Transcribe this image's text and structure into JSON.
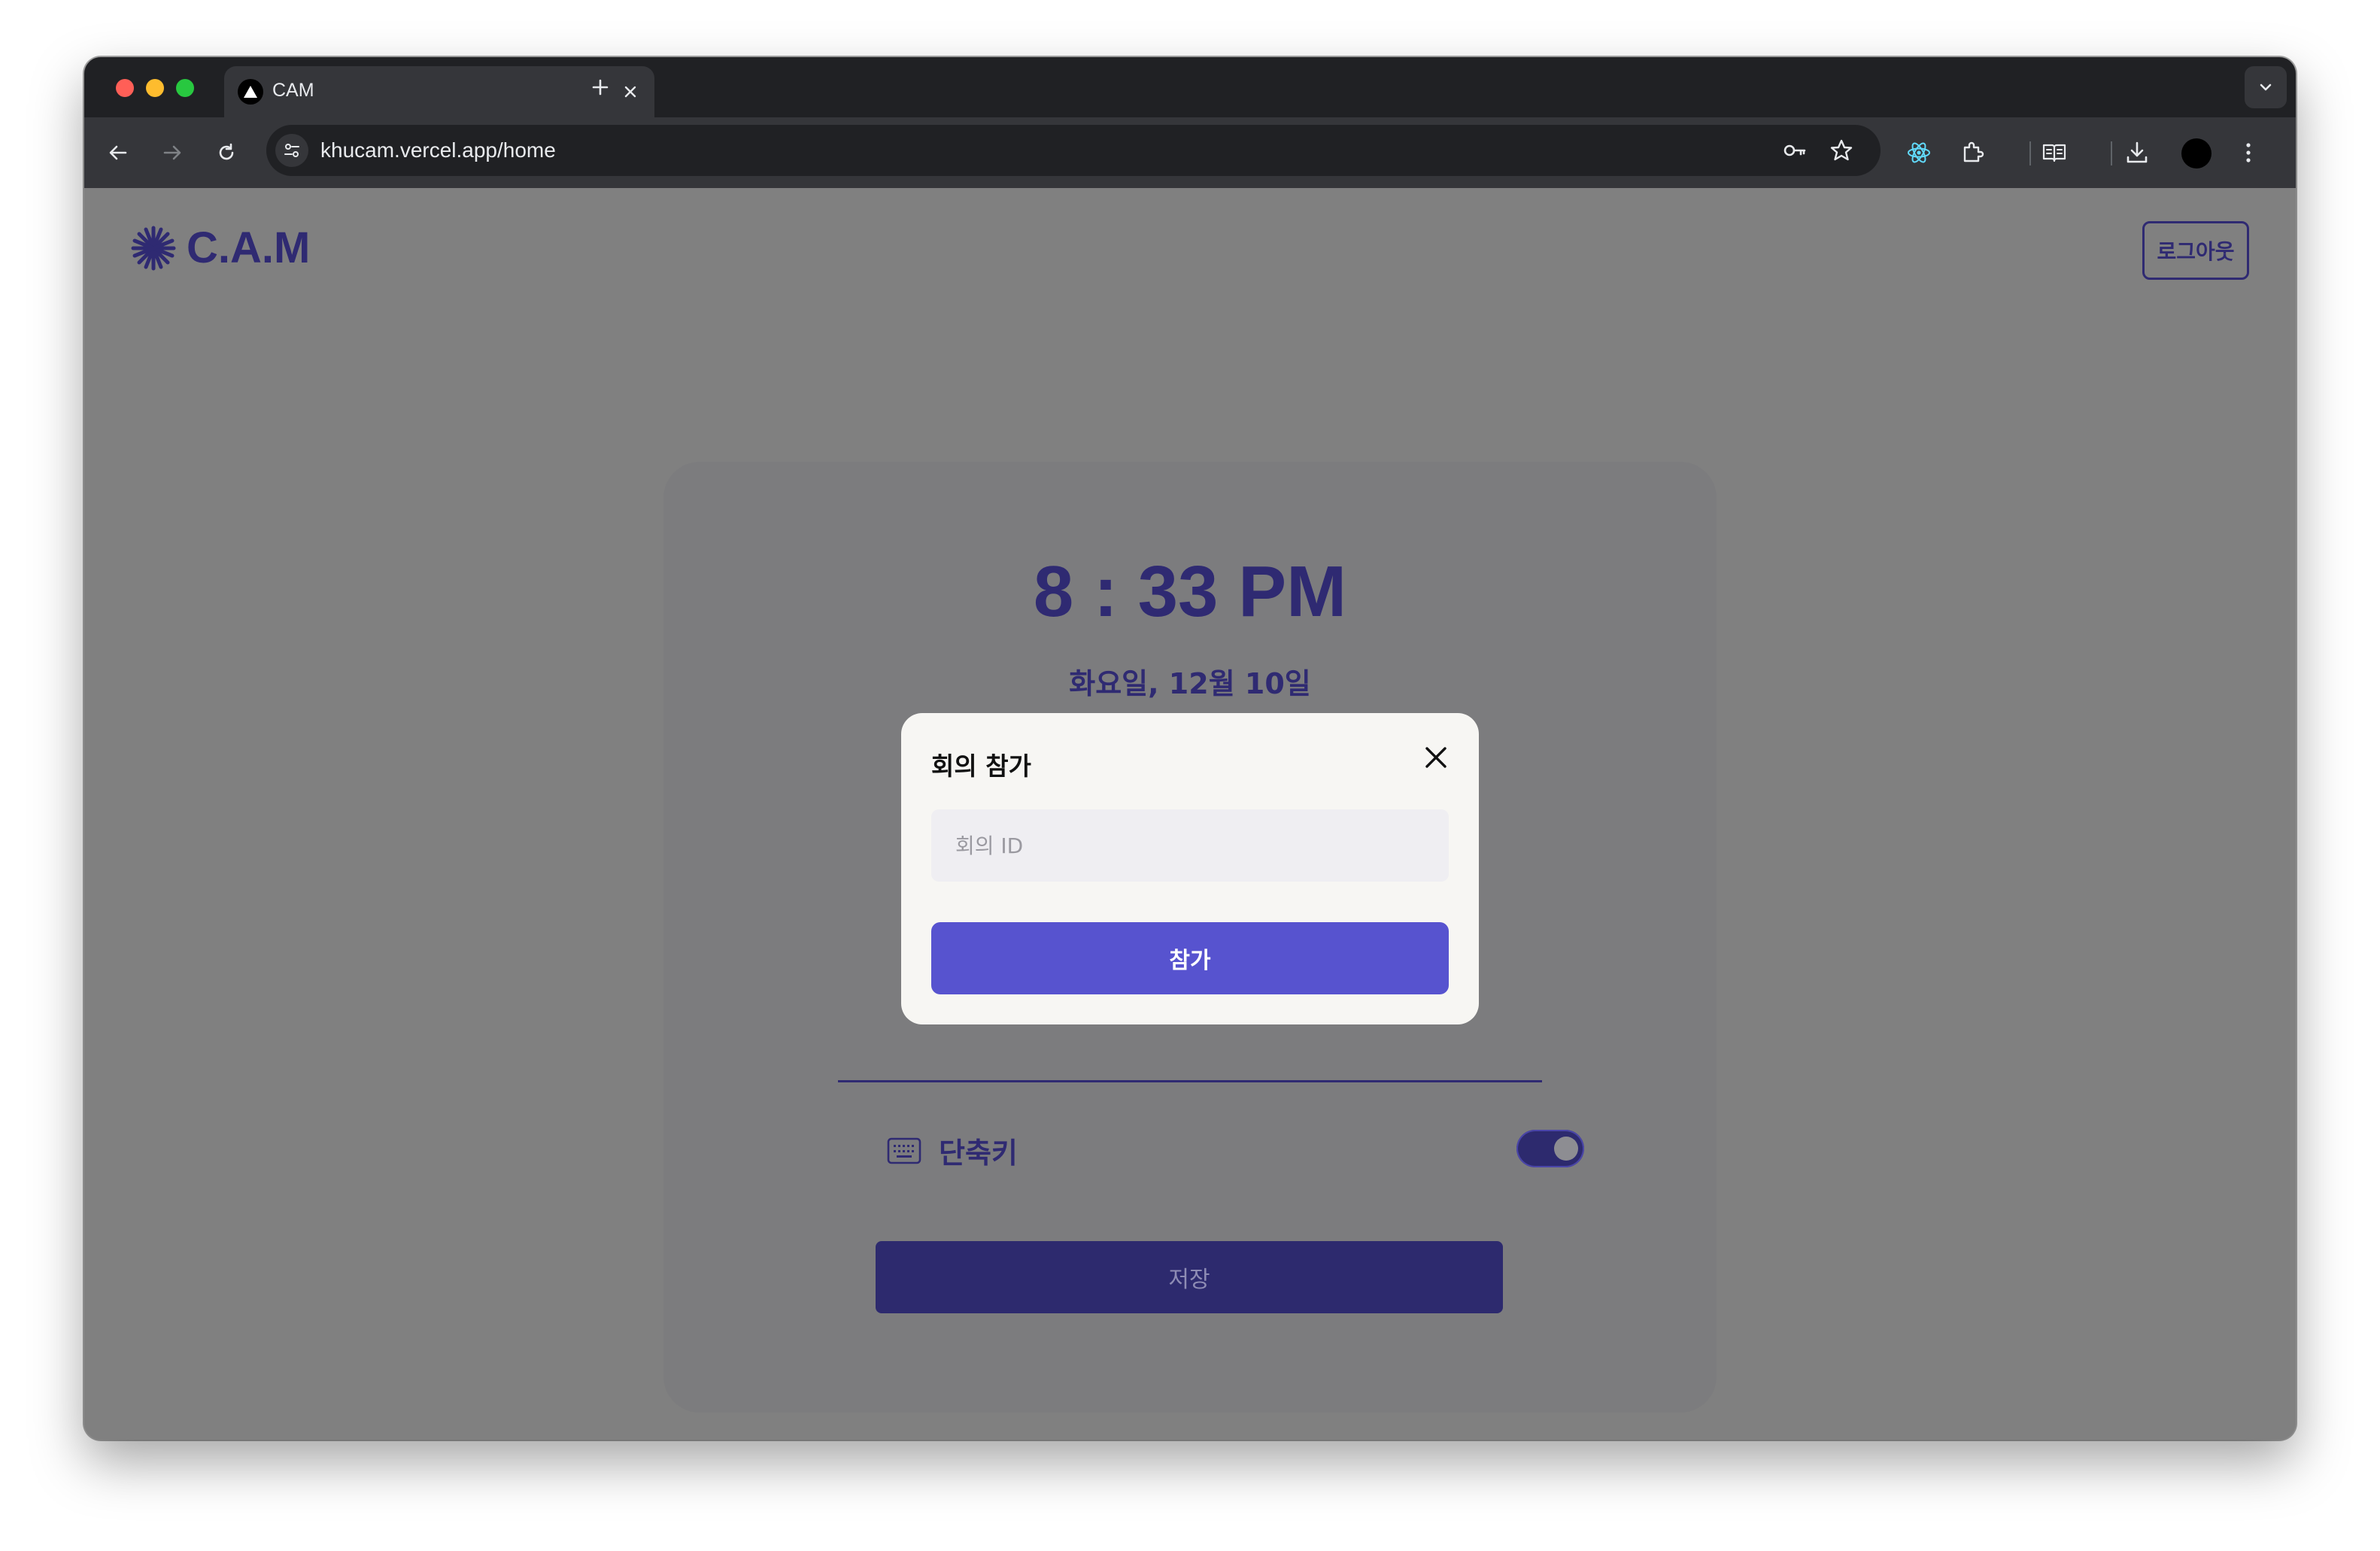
{
  "browser": {
    "tab_title": "CAM",
    "url": "khucam.vercel.app/home"
  },
  "header": {
    "brand": "C.A.M",
    "logout_label": "로그아웃"
  },
  "main": {
    "time": "8 : 33 PM",
    "date": "화요일, 12월 10일",
    "shortcut_label": "단축키",
    "shortcut_enabled": true,
    "save_label": "저장"
  },
  "modal": {
    "title": "회의 참가",
    "input_placeholder": "회의 ID",
    "input_value": "",
    "join_label": "참가"
  },
  "colors": {
    "brand": "#2f2a72",
    "primary_button": "#5753cf",
    "overlay": "#808080"
  }
}
